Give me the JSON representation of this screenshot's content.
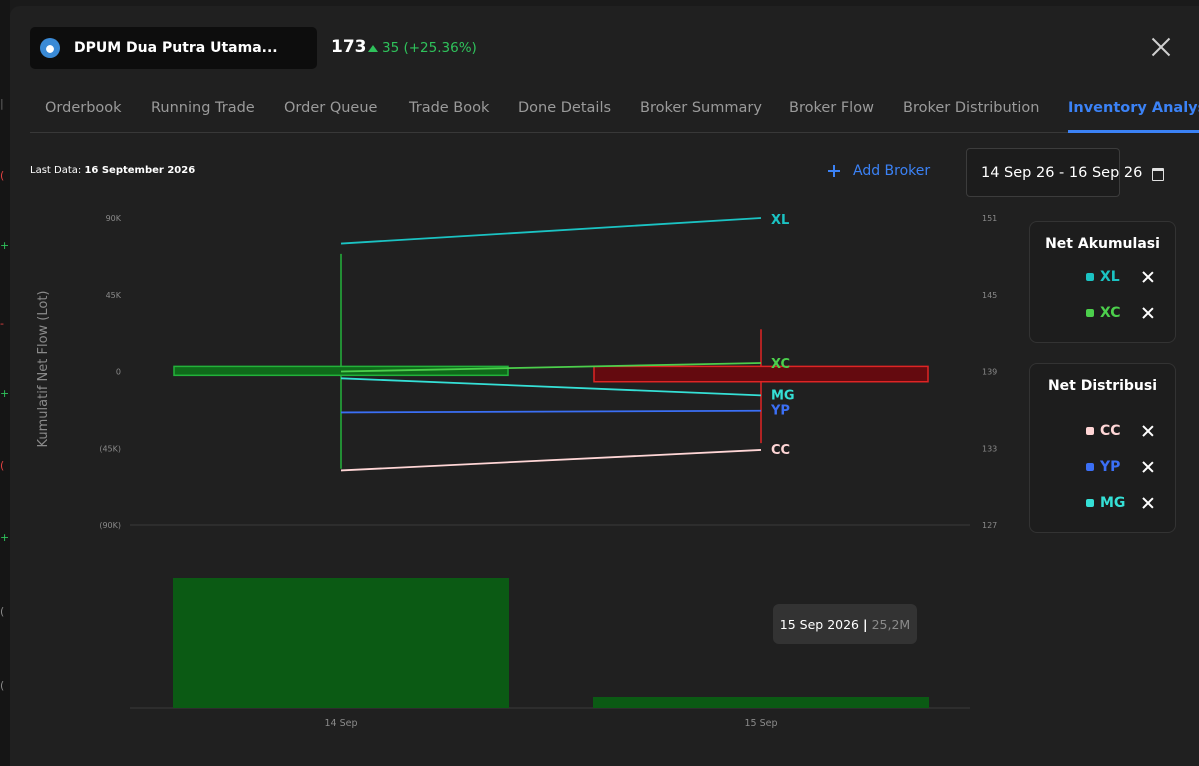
{
  "stock": {
    "name": "DPUM Dua Putra Utama...",
    "price": "173",
    "change": "35 (+25.36%)"
  },
  "tabs": [
    "Orderbook",
    "Running Trade",
    "Order Queue",
    "Trade Book",
    "Done Details",
    "Broker Summary",
    "Broker Flow",
    "Broker Distribution",
    "Inventory Analysis"
  ],
  "active_tab": "Inventory Analysis",
  "last_data": {
    "label": "Last Data:",
    "value": "16 September 2026"
  },
  "add_broker_label": "Add Broker",
  "date_range": "14 Sep 26 - 16 Sep 26",
  "net_akumulasi": {
    "title": "Net Akumulasi",
    "items": [
      {
        "code": "XL",
        "color": "#1bc3c3"
      },
      {
        "code": "XC",
        "color": "#4ccf4c"
      }
    ]
  },
  "net_distribusi": {
    "title": "Net Distribusi",
    "items": [
      {
        "code": "CC",
        "color": "#ffd6d6"
      },
      {
        "code": "YP",
        "color": "#3b6ff5"
      },
      {
        "code": "MG",
        "color": "#35e0d6"
      }
    ]
  },
  "tooltip": {
    "date": "15 Sep 2026",
    "separator": "|",
    "value": "25,2M"
  },
  "chart_data": {
    "type": "line",
    "ylabel": "Kumulatif Net Flow (Lot)",
    "ylim": [
      -90000,
      90000
    ],
    "y_ticks": [
      "90K",
      "45K",
      "0",
      "(45K)",
      "(90K)"
    ],
    "y_tick_values": [
      90000,
      45000,
      0,
      -45000,
      -90000
    ],
    "y2lim": [
      127,
      151
    ],
    "y2_ticks": [
      "151",
      "145",
      "139",
      "133",
      "127"
    ],
    "y2_tick_values": [
      151,
      145,
      139,
      133,
      127
    ],
    "categories": [
      "14 Sep",
      "15 Sep"
    ],
    "series": [
      {
        "name": "XL",
        "color": "#1bc3c3",
        "values": [
          75000,
          90000
        ]
      },
      {
        "name": "XC",
        "color": "#4ccf4c",
        "values": [
          0,
          5000
        ]
      },
      {
        "name": "MG",
        "color": "#35e0d6",
        "values": [
          -4000,
          -14000
        ]
      },
      {
        "name": "YP",
        "color": "#3b6ff5",
        "values": [
          -24000,
          -23000
        ]
      },
      {
        "name": "CC",
        "color": "#ffd6d6",
        "values": [
          -58000,
          -46000
        ]
      }
    ],
    "candles": [
      {
        "x": "14 Sep",
        "open": 138.7,
        "close": 139.4,
        "high": 148.2,
        "low": 131.4,
        "color": "#23b23a"
      },
      {
        "x": "15 Sep",
        "open": 139.4,
        "close": 138.2,
        "high": 142.3,
        "low": 133.4,
        "color": "#e02424"
      }
    ],
    "volume": [
      {
        "x": "14 Sep",
        "value": "",
        "color": "#0b5a14"
      },
      {
        "x": "15 Sep",
        "value": "25,2M",
        "color": "#0b5a14"
      }
    ],
    "grid": false
  }
}
